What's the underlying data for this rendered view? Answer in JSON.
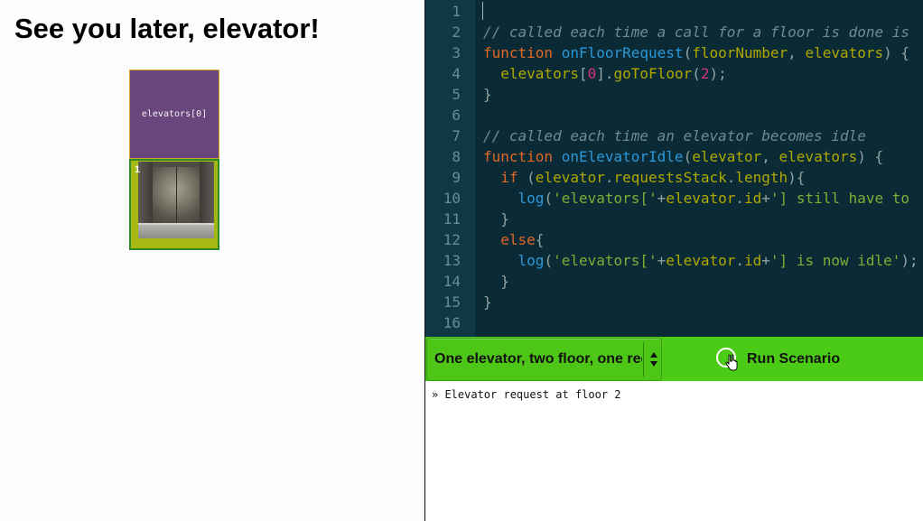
{
  "page": {
    "title": "See you later, elevator!"
  },
  "building": {
    "floors": [
      {
        "label": "elevators[0]",
        "color": "#69477c"
      },
      {
        "number": "1",
        "color": "#a6b812"
      }
    ]
  },
  "editor": {
    "colors": {
      "background": "#0a2b36",
      "comment": "#6e8a93",
      "keyword": "#e06726",
      "function": "#2b97d8",
      "param": "#b0a800",
      "number": "#d3367f",
      "string": "#7dae35"
    },
    "lines": [
      {
        "num": "1",
        "tokens": []
      },
      {
        "num": "2",
        "tokens": [
          {
            "t": "// called each time a call for a floor is done is",
            "c": "comment"
          }
        ]
      },
      {
        "num": "3",
        "tokens": [
          {
            "t": "function",
            "c": "keyword"
          },
          {
            "t": " ",
            "c": "plain"
          },
          {
            "t": "onFloorRequest",
            "c": "func"
          },
          {
            "t": "(",
            "c": "punct"
          },
          {
            "t": "floorNumber",
            "c": "param"
          },
          {
            "t": ", ",
            "c": "punct"
          },
          {
            "t": "elevators",
            "c": "param"
          },
          {
            "t": ") {",
            "c": "punct"
          }
        ]
      },
      {
        "num": "4",
        "tokens": [
          {
            "t": "  ",
            "c": "plain"
          },
          {
            "t": "elevators",
            "c": "param"
          },
          {
            "t": "[",
            "c": "punct"
          },
          {
            "t": "0",
            "c": "num"
          },
          {
            "t": "].",
            "c": "punct"
          },
          {
            "t": "goToFloor",
            "c": "param"
          },
          {
            "t": "(",
            "c": "punct"
          },
          {
            "t": "2",
            "c": "num"
          },
          {
            "t": ");",
            "c": "punct"
          }
        ]
      },
      {
        "num": "5",
        "tokens": [
          {
            "t": "}",
            "c": "punct"
          }
        ]
      },
      {
        "num": "6",
        "tokens": []
      },
      {
        "num": "7",
        "tokens": [
          {
            "t": "// called each time an elevator becomes idle",
            "c": "comment"
          }
        ]
      },
      {
        "num": "8",
        "tokens": [
          {
            "t": "function",
            "c": "keyword"
          },
          {
            "t": " ",
            "c": "plain"
          },
          {
            "t": "onElevatorIdle",
            "c": "func"
          },
          {
            "t": "(",
            "c": "punct"
          },
          {
            "t": "elevator",
            "c": "param"
          },
          {
            "t": ", ",
            "c": "punct"
          },
          {
            "t": "elevators",
            "c": "param"
          },
          {
            "t": ") {",
            "c": "punct"
          }
        ]
      },
      {
        "num": "9",
        "tokens": [
          {
            "t": "  ",
            "c": "plain"
          },
          {
            "t": "if",
            "c": "keyword"
          },
          {
            "t": " (",
            "c": "punct"
          },
          {
            "t": "elevator",
            "c": "param"
          },
          {
            "t": ".",
            "c": "punct"
          },
          {
            "t": "requestsStack",
            "c": "param"
          },
          {
            "t": ".",
            "c": "punct"
          },
          {
            "t": "length",
            "c": "param"
          },
          {
            "t": "){",
            "c": "punct"
          }
        ]
      },
      {
        "num": "10",
        "tokens": [
          {
            "t": "    ",
            "c": "plain"
          },
          {
            "t": "log",
            "c": "func"
          },
          {
            "t": "(",
            "c": "punct"
          },
          {
            "t": "'elevators['",
            "c": "str"
          },
          {
            "t": "+",
            "c": "punct"
          },
          {
            "t": "elevator",
            "c": "param"
          },
          {
            "t": ".",
            "c": "punct"
          },
          {
            "t": "id",
            "c": "param"
          },
          {
            "t": "+",
            "c": "punct"
          },
          {
            "t": "'] still have to",
            "c": "str"
          }
        ]
      },
      {
        "num": "11",
        "tokens": [
          {
            "t": "  }",
            "c": "punct"
          }
        ]
      },
      {
        "num": "12",
        "tokens": [
          {
            "t": "  ",
            "c": "plain"
          },
          {
            "t": "else",
            "c": "keyword"
          },
          {
            "t": "{",
            "c": "punct"
          }
        ]
      },
      {
        "num": "13",
        "tokens": [
          {
            "t": "    ",
            "c": "plain"
          },
          {
            "t": "log",
            "c": "func"
          },
          {
            "t": "(",
            "c": "punct"
          },
          {
            "t": "'elevators['",
            "c": "str"
          },
          {
            "t": "+",
            "c": "punct"
          },
          {
            "t": "elevator",
            "c": "param"
          },
          {
            "t": ".",
            "c": "punct"
          },
          {
            "t": "id",
            "c": "param"
          },
          {
            "t": "+",
            "c": "punct"
          },
          {
            "t": "'] is now idle'",
            "c": "str"
          },
          {
            "t": ");",
            "c": "punct"
          }
        ]
      },
      {
        "num": "14",
        "tokens": [
          {
            "t": "  }",
            "c": "punct"
          }
        ]
      },
      {
        "num": "15",
        "tokens": [
          {
            "t": "}",
            "c": "punct"
          }
        ]
      },
      {
        "num": "16",
        "tokens": []
      }
    ]
  },
  "controls": {
    "scenario_select": {
      "value": "One elevator, two floor, one request"
    },
    "run_button": {
      "label": "Run Scenario",
      "icon": "run-circle-icon",
      "color": "#4bcb16"
    }
  },
  "console": {
    "lines": [
      "» Elevator request at floor 2"
    ]
  }
}
